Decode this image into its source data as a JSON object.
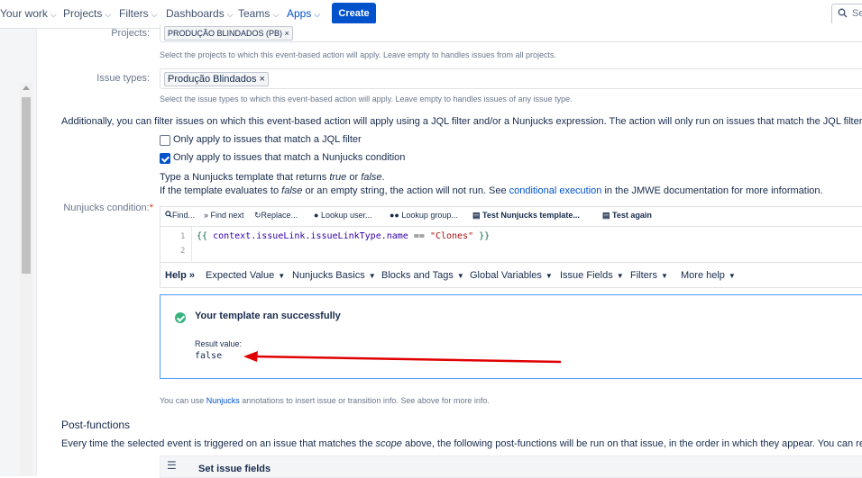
{
  "nav": {
    "items": [
      {
        "label": "Your work",
        "active": false
      },
      {
        "label": "Projects",
        "active": false
      },
      {
        "label": "Filters",
        "active": false
      },
      {
        "label": "Dashboards",
        "active": false
      },
      {
        "label": "Teams",
        "active": false
      },
      {
        "label": "Apps",
        "active": true
      }
    ],
    "create_label": "Create",
    "search_placeholder": "Se",
    "accent": "#0052cc"
  },
  "form": {
    "projects": {
      "label": "Projects:",
      "tag": "PRODUÇÃO BLINDADOS (PB)",
      "help": "Select the projects to which this event-based action will apply. Leave empty to handles issues from all projects."
    },
    "issue_types": {
      "label": "Issue types:",
      "tag": "Produção Blindados",
      "help": "Select the issue types to which this event-based action will apply. Leave empty to handles issues of any issue type."
    },
    "filter_intro": "Additionally, you can filter issues on which this event-based action will apply using a JQL filter and/or a Nunjucks expression. The action will only run on issues that match the JQL filter and/or th",
    "jql_checkbox": {
      "label": "Only apply to issues that match a JQL filter",
      "checked": false
    },
    "nunjucks_checkbox": {
      "label": "Only apply to issues that match a Nunjucks condition",
      "checked": true
    },
    "template_hint": {
      "l1_a": "Type a Nunjucks template that returns ",
      "l1_true": "true",
      "l1_or": " or ",
      "l1_false": "false",
      "l1_end": ".",
      "l2_a": "If the template evaluates to ",
      "l2_false": "false",
      "l2_b": " or an empty string, the action will not run. See ",
      "l2_link": "conditional execution",
      "l2_c": " in the JMWE documentation for more information."
    },
    "nunjucks_label": "Nunjucks condition:",
    "required_mark": "*"
  },
  "editor": {
    "toolbar": [
      "Find...",
      "Find next",
      "Replace...",
      "Lookup user...",
      "Lookup group...",
      "Test Nunjucks template...",
      "Test again"
    ],
    "lines": [
      "1",
      "2"
    ],
    "code": {
      "open": "{{",
      "expr": "context.issueLink.issueLinkType.name",
      "op": "==",
      "str": "\"Clones\"",
      "close": "}}"
    },
    "help_bar": {
      "help": "Help",
      "items": [
        "Expected Value",
        "Nunjucks Basics",
        "Blocks and Tags",
        "Global Variables",
        "Issue Fields",
        "Filters",
        "More help"
      ]
    }
  },
  "result": {
    "title": "Your template ran successfully",
    "value_label": "Result value:",
    "value": "false"
  },
  "annotation_note": {
    "a": "You can use ",
    "link": "Nunjucks",
    "b": " annotations to insert issue or transition info. See above for more info."
  },
  "post_functions": {
    "title": "Post-functions",
    "desc_a": "Every time the selected event is triggered on an issue that matches the ",
    "desc_scope": "scope",
    "desc_b": " above, the following post-functions will be run on that issue, in the order in which they appear. You can reorder the",
    "first_item": "Set issue fields"
  },
  "colors": {
    "success": "#36b37e",
    "arrow": "#e00000",
    "link": "#0052cc"
  }
}
